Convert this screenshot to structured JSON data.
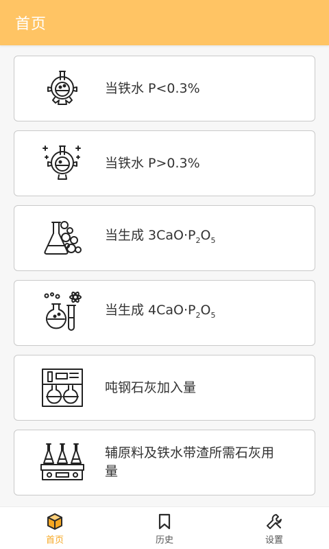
{
  "app_bar": {
    "title": "首页"
  },
  "colors": {
    "accent": "#ffc464",
    "active": "#f6a722",
    "card_border": "#c9c9c9"
  },
  "cards": [
    {
      "icon": "flask-gear-icon",
      "parts": [
        {
          "t": "当铁水 P<0.3%"
        }
      ]
    },
    {
      "icon": "flask-gear-sparkle-icon",
      "parts": [
        {
          "t": "当铁水 P>0.3%"
        }
      ]
    },
    {
      "icon": "flask-bubbles-icon",
      "parts": [
        {
          "t": "当生成 3CaO·P"
        },
        {
          "t": "2",
          "sub": true
        },
        {
          "t": "O"
        },
        {
          "t": "5",
          "sub": true
        }
      ]
    },
    {
      "icon": "flask-atom-testtube-icon",
      "parts": [
        {
          "t": "当生成 4CaO·P"
        },
        {
          "t": "2",
          "sub": true
        },
        {
          "t": "O"
        },
        {
          "t": "5",
          "sub": true
        }
      ]
    },
    {
      "icon": "lab-equipment-icon",
      "parts": [
        {
          "t": "吨钢石灰加入量"
        }
      ]
    },
    {
      "icon": "flasks-heater-icon",
      "parts": [
        {
          "t": "辅原料及铁水带渣所需石灰用量"
        }
      ]
    }
  ],
  "bottom_nav": [
    {
      "label": "首页",
      "icon": "box-icon",
      "active": true
    },
    {
      "label": "历史",
      "icon": "bookmark-icon",
      "active": false
    },
    {
      "label": "设置",
      "icon": "wrench-icon",
      "active": false
    }
  ]
}
